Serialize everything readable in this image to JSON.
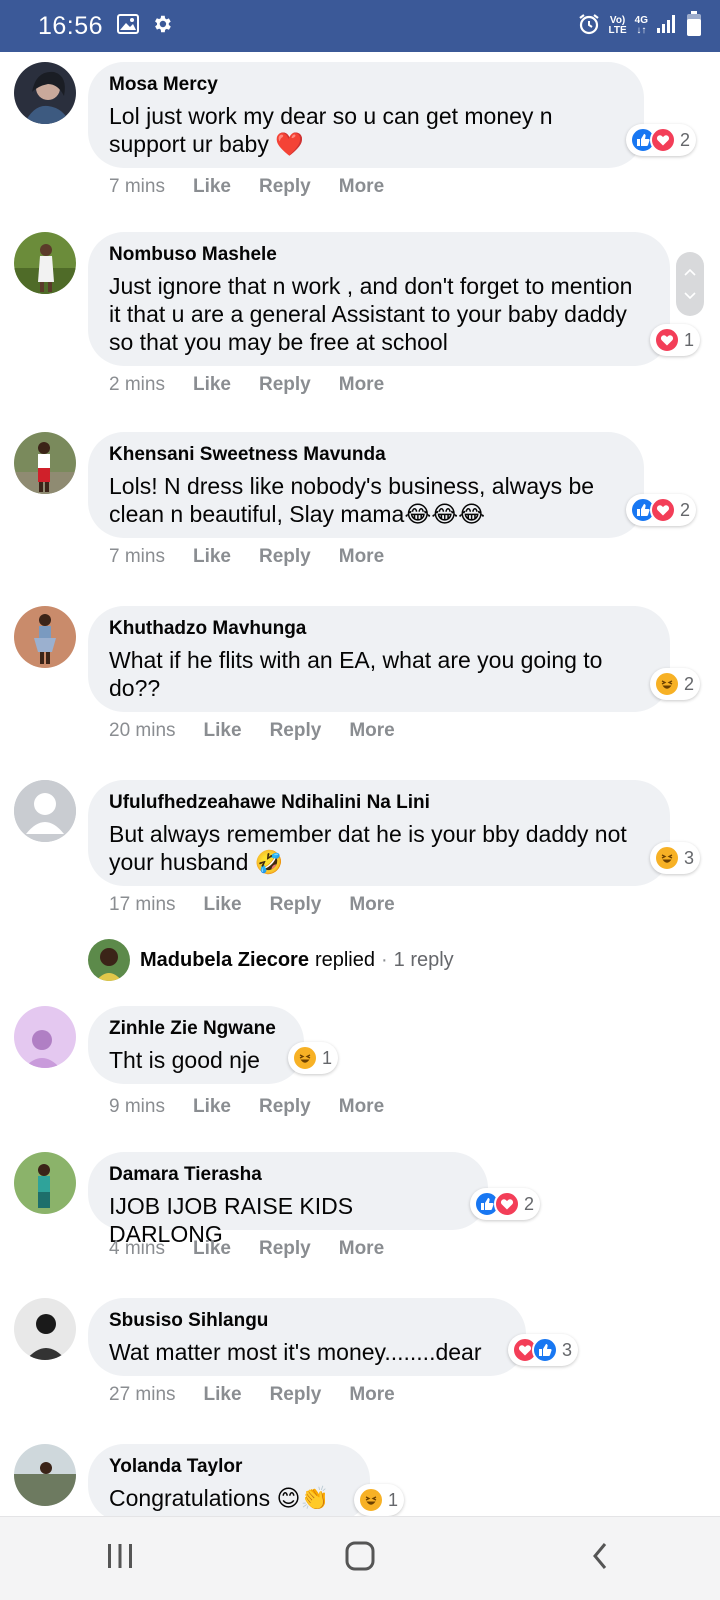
{
  "status_bar": {
    "time": "16:56",
    "left_icons": [
      "image-icon",
      "gear-icon"
    ],
    "right_icons": [
      "alarm-icon",
      "volte-icon",
      "4g-icon",
      "signal-icon",
      "battery-icon"
    ],
    "volte_line1": "Vo)",
    "volte_line2": "LTE",
    "net_line1": "4G",
    "net_line2": "↓↑",
    "bar_color": "#3b5998"
  },
  "comments": [
    {
      "author": "Mosa Mercy",
      "text": "Lol just work my dear so u can get money n support ur baby ❤️",
      "time": "7 mins",
      "like": "Like",
      "reply": "Reply",
      "more": "More",
      "reactions": [
        "like",
        "love"
      ],
      "reaction_count": "2"
    },
    {
      "author": "Nombuso Mashele",
      "text": "Just ignore that n work , and don't forget to mention it that u are a general Assistant to your baby daddy so that you may be free at school",
      "time": "2 mins",
      "like": "Like",
      "reply": "Reply",
      "more": "More",
      "reactions": [
        "love"
      ],
      "reaction_count": "1"
    },
    {
      "author": "Khensani Sweetness Mavunda",
      "text": "Lols! N dress like nobody's business, always be clean n beautiful, Slay mama😂😂😂",
      "time": "7 mins",
      "like": "Like",
      "reply": "Reply",
      "more": "More",
      "reactions": [
        "like",
        "love"
      ],
      "reaction_count": "2"
    },
    {
      "author": "Khuthadzo Mavhunga",
      "text": "What if he flits with an EA, what are you going to do??",
      "time": "20 mins",
      "like": "Like",
      "reply": "Reply",
      "more": "More",
      "reactions": [
        "haha"
      ],
      "reaction_count": "2"
    },
    {
      "author": "Ufulufhedzeahawe Ndihalini Na Lini",
      "text": "But always remember dat he is your bby daddy not your husband 🤣",
      "time": "17 mins",
      "like": "Like",
      "reply": "Reply",
      "more": "More",
      "reactions": [
        "haha"
      ],
      "reaction_count": "3"
    },
    {
      "author": "Zinhle Zie Ngwane",
      "text": "Tht is good nje",
      "time": "9 mins",
      "like": "Like",
      "reply": "Reply",
      "more": "More",
      "reactions": [
        "haha"
      ],
      "reaction_count": "1"
    },
    {
      "author": "Damara Tierasha",
      "text": "IJOB IJOB RAISE KIDS DARLONG",
      "time": "4 mins",
      "like": "Like",
      "reply": "Reply",
      "more": "More",
      "reactions": [
        "like",
        "love"
      ],
      "reaction_count": "2"
    },
    {
      "author": "Sbusiso Sihlangu",
      "text": "Wat matter most it's money........dear",
      "time": "27 mins",
      "like": "Like",
      "reply": "Reply",
      "more": "More",
      "reactions": [
        "love",
        "like"
      ],
      "reaction_count": "3"
    },
    {
      "author": "Yolanda Taylor",
      "text": "Congratulations 😊👏",
      "time": "",
      "like": "",
      "reply": "",
      "more": "",
      "reactions": [
        "haha"
      ],
      "reaction_count": "1"
    }
  ],
  "replies_row": {
    "name": "Madubela Ziecore",
    "verb": "replied",
    "dot": "·",
    "count": "1 reply"
  },
  "nav_bar": {
    "buttons": [
      "recents-icon",
      "home-icon",
      "back-icon"
    ]
  },
  "colors": {
    "like_blue": "#1877f2",
    "love_red": "#f33e58",
    "haha_yellow": "#f7b125",
    "bubble_gray": "#eff1f4",
    "meta_gray": "#8a8d91"
  }
}
